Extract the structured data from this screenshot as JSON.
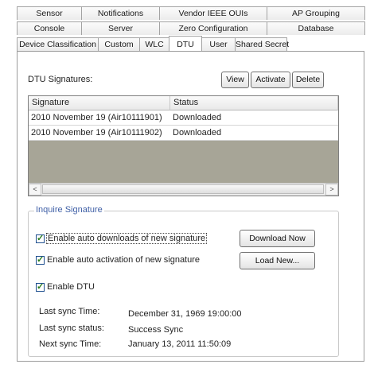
{
  "tabs": {
    "row1": [
      "Sensor",
      "Notifications",
      "Vendor IEEE OUIs",
      "AP Grouping"
    ],
    "row2": [
      "Console",
      "Server",
      "Zero Configuration",
      "Database"
    ],
    "row3": [
      "Device Classification",
      "Custom",
      "WLC",
      "DTU",
      "User",
      "Shared Secret"
    ],
    "active": "DTU"
  },
  "signatures": {
    "label": "DTU Signatures:",
    "buttons": {
      "view": "View",
      "activate": "Activate",
      "delete": "Delete"
    },
    "columns": [
      "Signature",
      "Status"
    ],
    "rows": [
      {
        "signature": "2010 November 19 (Air10111901)",
        "status": "Downloaded"
      },
      {
        "signature": "2010 November 19 (Air10111902)",
        "status": "Downloaded"
      }
    ],
    "scroll_left": "<",
    "scroll_right": ">"
  },
  "inquire": {
    "legend": "Inquire Signature",
    "auto_download": {
      "label": "Enable auto downloads of new signature",
      "checked": true
    },
    "auto_activation": {
      "label": "Enable auto activation of new signature",
      "checked": true
    },
    "enable_dtu": {
      "label": "Enable DTU",
      "checked": true
    },
    "download_now": "Download Now",
    "load_new": "Load New...",
    "sync": [
      {
        "label": "Last sync Time:",
        "value": "December 31, 1969 19:00:00"
      },
      {
        "label": "Last sync status:",
        "value": "Success Sync"
      },
      {
        "label": "Next sync Time:",
        "value": "January 13, 2011 11:50:09"
      }
    ]
  }
}
